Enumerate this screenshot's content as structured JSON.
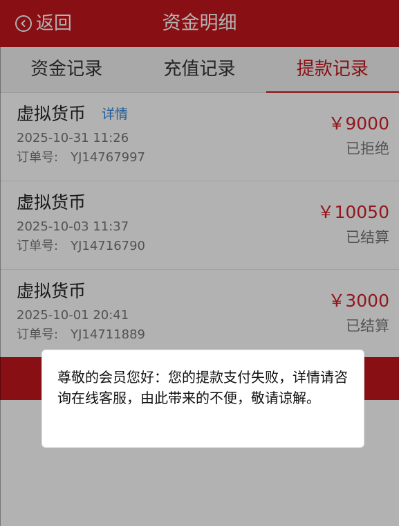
{
  "header": {
    "back_label": "返回",
    "title": "资金明细"
  },
  "tabs": [
    {
      "label": "资金记录",
      "active": false
    },
    {
      "label": "充值记录",
      "active": false
    },
    {
      "label": "提款记录",
      "active": true
    }
  ],
  "records": [
    {
      "name": "虚拟货币",
      "detail_link": "详情",
      "time": "2025-10-31 11:26",
      "order_label": "订单号:",
      "order_no": "YJ14767997",
      "amount": "￥9000",
      "status": "已拒绝"
    },
    {
      "name": "虚拟货币",
      "detail_link": "",
      "time": "2025-10-03 11:37",
      "order_label": "订单号:",
      "order_no": "YJ14716790",
      "amount": "￥10050",
      "status": "已结算"
    },
    {
      "name": "虚拟货币",
      "detail_link": "",
      "time": "2025-10-01 20:41",
      "order_label": "订单号:",
      "order_no": "YJ14711889",
      "amount": "￥3000",
      "status": "已结算"
    }
  ],
  "dialog": {
    "message": "尊敬的会员您好：您的提款支付失败，详情请咨询在线客服，由此带来的不便，敬请谅解。"
  },
  "colors": {
    "brand_red": "#c3161c",
    "amount_red": "#d0202a",
    "link_blue": "#2e86de"
  }
}
